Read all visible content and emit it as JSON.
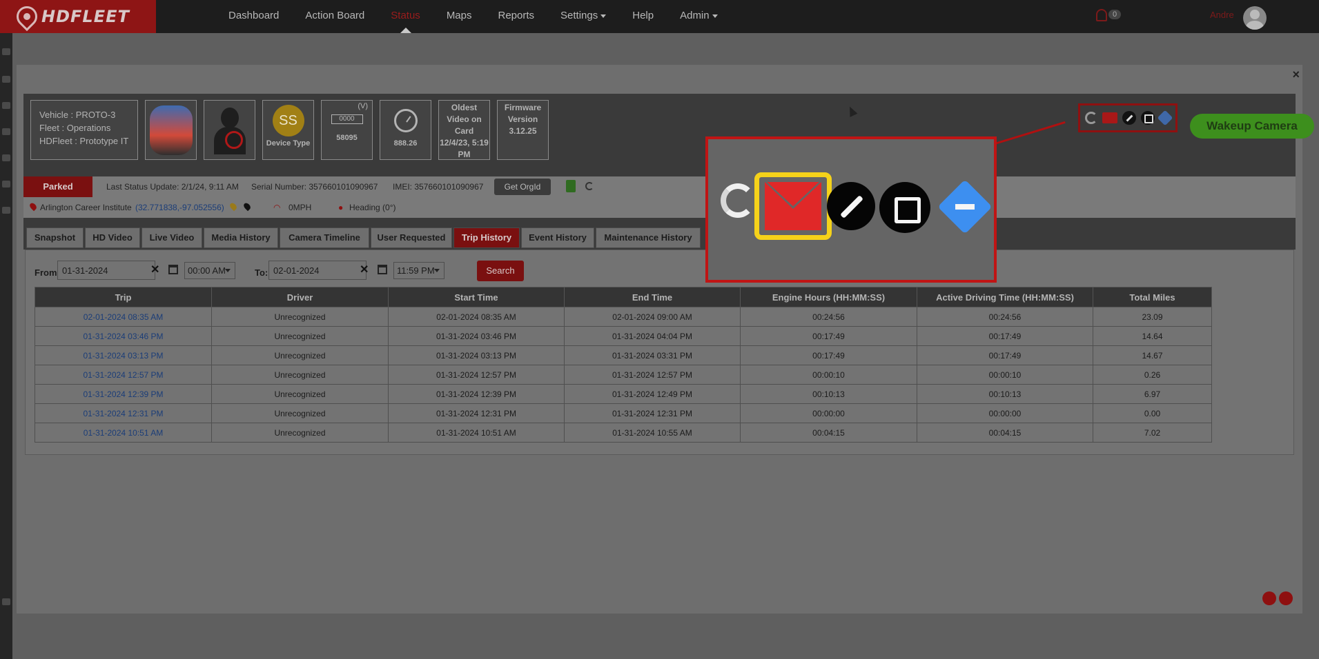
{
  "app": {
    "logo_text": "HDFLEET"
  },
  "nav": {
    "items": [
      "Dashboard",
      "Action Board",
      "Status",
      "Maps",
      "Reports",
      "Settings",
      "Help",
      "Admin"
    ],
    "active": "Status",
    "notification_count": "0",
    "user_name": "Andre"
  },
  "modal": {
    "close_label": "×"
  },
  "vehicle": {
    "vehicle_line": "Vehicle : PROTO-3",
    "fleet_line": "Fleet : Operations",
    "hdfleet_line": "HDFleet : Prototype IT",
    "device_initials": "SS",
    "device_type_label": "Device Type",
    "odometer_digits": "0000",
    "voltage_unit": "(V)",
    "odometer_value": "58095",
    "hours_value": "888.26",
    "oldest_video_label": "Oldest Video on Card",
    "oldest_video_value": "12/4/23, 5:19 PM",
    "firmware_label": "Firmware Version",
    "firmware_value": "3.12.25"
  },
  "actions": {
    "wakeup_label": "Wakeup Camera"
  },
  "status": {
    "state": "Parked",
    "last_update": "Last Status Update: 2/1/24, 9:11 AM",
    "serial": "Serial Number: 357660101090967",
    "imei": "IMEI: 357660101090967",
    "get_orgid_label": "Get OrgId"
  },
  "location": {
    "place": "Arlington Career Institute",
    "coords": "(32.771838,-97.052556)",
    "speed": "0MPH",
    "heading": "Heading (0°)"
  },
  "tabs": [
    "Snapshot",
    "HD Video",
    "Live Video",
    "Media History",
    "Camera Timeline",
    "User Requested",
    "Trip History",
    "Event History",
    "Maintenance History"
  ],
  "active_tab": "Trip History",
  "filter": {
    "from_label": "From:",
    "from_date": "01-31-2024",
    "from_time": "00:00 AM",
    "to_label": "To:",
    "to_date": "02-01-2024",
    "to_time": "11:59 PM",
    "search_label": "Search"
  },
  "table": {
    "headers": [
      "Trip",
      "Driver",
      "Start Time",
      "End Time",
      "Engine Hours (HH:MM:SS)",
      "Active Driving Time (HH:MM:SS)",
      "Total Miles"
    ],
    "rows": [
      [
        "02-01-2024 08:35 AM",
        "Unrecognized",
        "02-01-2024 08:35 AM",
        "02-01-2024 09:00 AM",
        "00:24:56",
        "00:24:56",
        "23.09"
      ],
      [
        "01-31-2024 03:46 PM",
        "Unrecognized",
        "01-31-2024 03:46 PM",
        "01-31-2024 04:04 PM",
        "00:17:49",
        "00:17:49",
        "14.64"
      ],
      [
        "01-31-2024 03:13 PM",
        "Unrecognized",
        "01-31-2024 03:13 PM",
        "01-31-2024 03:31 PM",
        "00:17:49",
        "00:17:49",
        "14.67"
      ],
      [
        "01-31-2024 12:57 PM",
        "Unrecognized",
        "01-31-2024 12:57 PM",
        "01-31-2024 12:57 PM",
        "00:00:10",
        "00:00:10",
        "0.26"
      ],
      [
        "01-31-2024 12:39 PM",
        "Unrecognized",
        "01-31-2024 12:39 PM",
        "01-31-2024 12:49 PM",
        "00:10:13",
        "00:10:13",
        "6.97"
      ],
      [
        "01-31-2024 12:31 PM",
        "Unrecognized",
        "01-31-2024 12:31 PM",
        "01-31-2024 12:31 PM",
        "00:00:00",
        "00:00:00",
        "0.00"
      ],
      [
        "01-31-2024 10:51 AM",
        "Unrecognized",
        "01-31-2024 10:51 AM",
        "01-31-2024 10:55 AM",
        "00:04:15",
        "00:04:15",
        "7.02"
      ]
    ]
  },
  "icons": {
    "toolbar": [
      "refresh-icon",
      "mail-icon",
      "wrench-icon",
      "edit-icon",
      "directions-icon"
    ],
    "highlighted": "mail-icon"
  },
  "colors": {
    "brand_red": "#8e1515",
    "highlight_yellow": "#f5d21a",
    "wakeup_green": "#3d8f1d"
  }
}
